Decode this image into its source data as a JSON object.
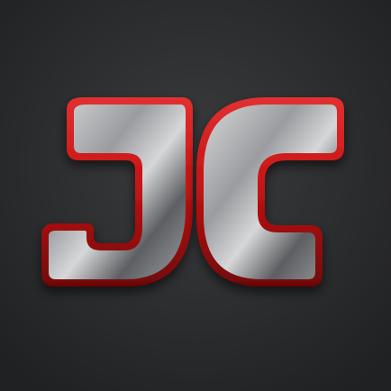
{
  "app_icon": {
    "logo_text": "JC",
    "colors": {
      "background_center": "#3b3c3e",
      "background_edge": "#202123",
      "outline_red": "#c81414",
      "outline_red_dark": "#6e0606",
      "metal_light": "#d6d7d9",
      "metal_mid": "#9a9c9f",
      "metal_dark": "#5d5f62"
    }
  }
}
